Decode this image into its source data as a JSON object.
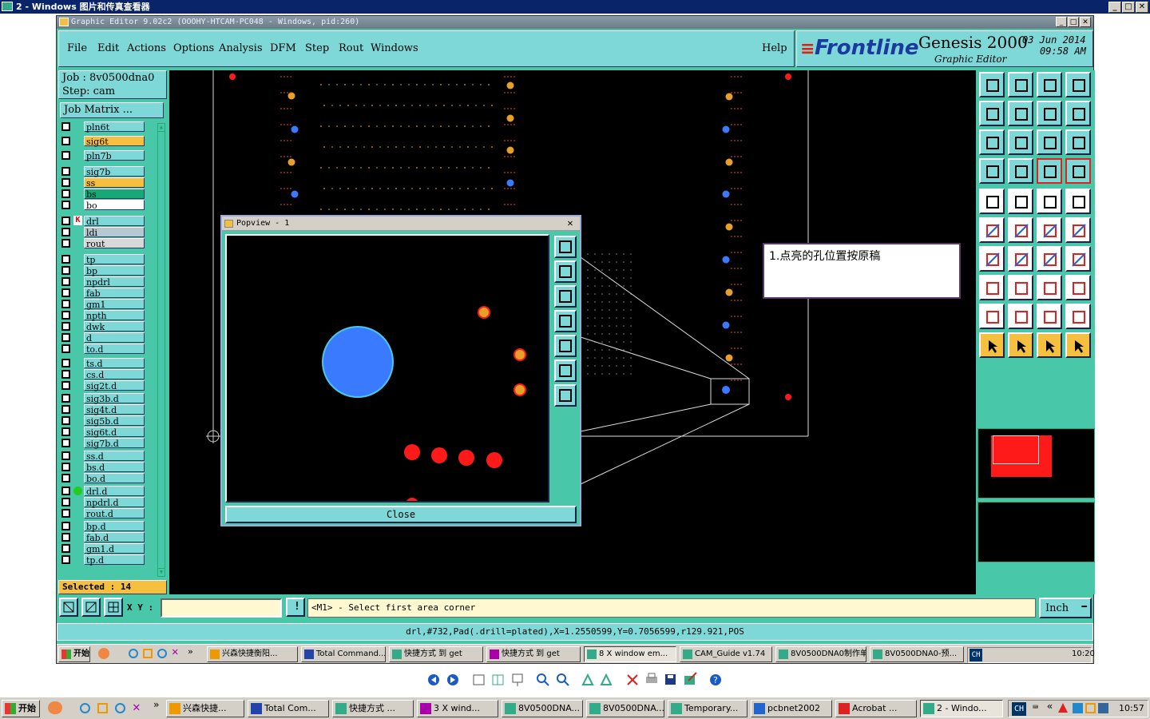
{
  "viewer": {
    "title": "2 - Windows 图片和传真查看器",
    "btn_min": "_",
    "btn_max": "□",
    "btn_close": "✕"
  },
  "app": {
    "title": "Graphic Editor 9.02c2 (OOOHY-HTCAM-PC048 - Windows, pid:260)",
    "menus": {
      "file": "File",
      "edit": "Edit",
      "actions": "Actions",
      "options": "Options",
      "analysis": "Analysis",
      "dfm": "DFM",
      "step": "Step",
      "rout": "Rout",
      "windows": "Windows",
      "help": "Help"
    },
    "logo": {
      "brand": "Frontline",
      "product": "Genesis 2000",
      "subtitle": "Graphic Editor",
      "date": "03 Jun 2014",
      "time": "09:58 AM"
    }
  },
  "left_panel": {
    "job": "Job : 8v0500dna0",
    "step": "Step: cam",
    "job_matrix": "Job Matrix ...",
    "layers": [
      {
        "name": "pln6t",
        "color": "#7fd8d8"
      },
      {
        "name": "sig6t",
        "color": "#f5c040"
      },
      {
        "name": "pln7b",
        "color": "#7fd8d8"
      },
      {
        "name": "sig7b",
        "color": "#7fd8d8"
      },
      {
        "name": "ss",
        "color": "#f5c040"
      },
      {
        "name": "bs",
        "color": "#18a878"
      },
      {
        "name": "bo",
        "color": "#ffffff"
      },
      {
        "name": "drl",
        "color": "#7fd8d8"
      },
      {
        "name": "ldi",
        "color": "#b8c8d0"
      },
      {
        "name": "rout",
        "color": "#d8d8d8"
      },
      {
        "name": "tp",
        "color": "#7fd8d8"
      },
      {
        "name": "bp",
        "color": "#7fd8d8"
      },
      {
        "name": "npdrl",
        "color": "#7fd8d8"
      },
      {
        "name": "fab",
        "color": "#7fd8d8"
      },
      {
        "name": "gm1",
        "color": "#7fd8d8"
      },
      {
        "name": "npth",
        "color": "#7fd8d8"
      },
      {
        "name": "dwk",
        "color": "#7fd8d8"
      },
      {
        "name": "d",
        "color": "#7fd8d8"
      },
      {
        "name": "to.d",
        "color": "#7fd8d8"
      },
      {
        "name": "ts.d",
        "color": "#7fd8d8"
      },
      {
        "name": "cs.d",
        "color": "#7fd8d8"
      },
      {
        "name": "sig2t.d",
        "color": "#7fd8d8"
      },
      {
        "name": "sig3b.d",
        "color": "#7fd8d8"
      },
      {
        "name": "sig4t.d",
        "color": "#7fd8d8"
      },
      {
        "name": "sig5b.d",
        "color": "#7fd8d8"
      },
      {
        "name": "sig6t.d",
        "color": "#7fd8d8"
      },
      {
        "name": "sig7b.d",
        "color": "#7fd8d8"
      },
      {
        "name": "ss.d",
        "color": "#7fd8d8"
      },
      {
        "name": "bs.d",
        "color": "#7fd8d8"
      },
      {
        "name": "bo.d",
        "color": "#7fd8d8"
      },
      {
        "name": "drl.d",
        "color": "#7fd8d8"
      },
      {
        "name": "npdrl.d",
        "color": "#7fd8d8"
      },
      {
        "name": "rout.d",
        "color": "#7fd8d8"
      },
      {
        "name": "bp.d",
        "color": "#7fd8d8"
      },
      {
        "name": "fab.d",
        "color": "#7fd8d8"
      },
      {
        "name": "gm1.d",
        "color": "#7fd8d8"
      },
      {
        "name": "tp.d",
        "color": "#7fd8d8"
      }
    ],
    "selected": "Selected : 14"
  },
  "popview": {
    "title": "Popview - 1",
    "close_label": "Close",
    "btn_close": "✕"
  },
  "annotation": {
    "text": "1.点亮的孔位置按原稿"
  },
  "command": {
    "xy_label": "X Y :",
    "xy_value": "",
    "prompt": "<M1> - Select first area corner",
    "units": "Inch"
  },
  "status_line": "drl,#732,Pad(.drill=plated),X=1.2550599,Y=0.7056599,r129.921,POS",
  "inner_taskbar": {
    "start": "开始",
    "items": [
      "兴森快捷衡阳...",
      "Total Command...",
      "快捷方式 到 get",
      "快捷方式 到 get",
      "8 X window em...",
      "CAM_Guide v1.74",
      "8V0500DNA0制作单",
      "8V0500DNA0-预..."
    ],
    "lang": "CH",
    "clock": "10:20"
  },
  "outer_taskbar": {
    "start": "开始",
    "items": [
      "兴森快捷...",
      "Total Com...",
      "快捷方式 ...",
      "3 X wind...",
      "8V0500DNA...",
      "8V0500DNA...",
      "Temporary...",
      "pcbnet2002",
      "Acrobat ...",
      "2 - Windo..."
    ],
    "lang": "CH",
    "clock": "10:57"
  },
  "colors": {
    "teal": "#48c8a8",
    "light_teal": "#7fd8d8",
    "pad_red": "#ff1a1a",
    "pad_orange": "#e8a028",
    "pad_blue": "#3a7aff"
  }
}
